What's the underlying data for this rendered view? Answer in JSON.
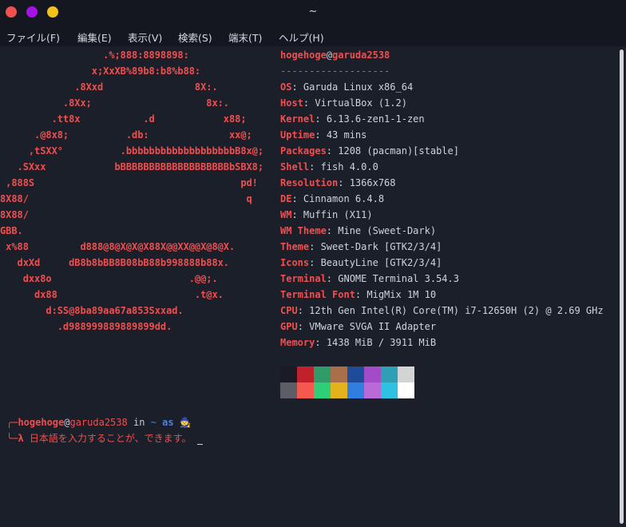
{
  "window": {
    "title": "~"
  },
  "menu": [
    "ファイル(F)",
    "編集(E)",
    "表示(V)",
    "検索(S)",
    "端末(T)",
    "ヘルプ(H)"
  ],
  "logo": [
    "                  .%;888:8898898:",
    "                x;XxXB%89b8:b8%b88:",
    "             .8Xxd                8X:.",
    "           .8Xx;                    8x:.",
    "         .tt8x           .d            x88;",
    "      .@8x8;          .db:              xx@;",
    "     ,tSXX°          .bbbbbbbbbbbbbbbbbbbB8x@;",
    "   .SXxx            bBBBBBBBBBBBBBBBBBBBbSBX8;",
    " ,888S                                    pd!",
    "8X88/                                      q",
    "8X88/",
    "GBB.",
    " x%88         d888@8@X@X@X88X@@XX@@X@8@X.",
    "   dxXd     dB8b8bBB8B08bB88b998888b88x.",
    "    dxx8o                        .@@;.",
    "      dx88                        .t@x.",
    "        d:SS@8ba89aa67a853Sxxad.",
    "          .d988999889889899dd."
  ],
  "system": {
    "user": "hogehoge",
    "host": "garuda2538",
    "separator": "-------------------",
    "fields": [
      {
        "key": "OS",
        "value": "Garuda Linux x86_64"
      },
      {
        "key": "Host",
        "value": "VirtualBox (1.2)"
      },
      {
        "key": "Kernel",
        "value": "6.13.6-zen1-1-zen"
      },
      {
        "key": "Uptime",
        "value": "43 mins"
      },
      {
        "key": "Packages",
        "value": "1208 (pacman)[stable]"
      },
      {
        "key": "Shell",
        "value": "fish 4.0.0"
      },
      {
        "key": "Resolution",
        "value": "1366x768"
      },
      {
        "key": "DE",
        "value": "Cinnamon 6.4.8"
      },
      {
        "key": "WM",
        "value": "Muffin (X11)"
      },
      {
        "key": "WM Theme",
        "value": "Mine (Sweet-Dark)"
      },
      {
        "key": "Theme",
        "value": "Sweet-Dark [GTK2/3/4]"
      },
      {
        "key": "Icons",
        "value": "BeautyLine [GTK2/3/4]"
      },
      {
        "key": "Terminal",
        "value": "GNOME Terminal 3.54.3"
      },
      {
        "key": "Terminal Font",
        "value": "MigMix 1M 10"
      },
      {
        "key": "CPU",
        "value": "12th Gen Intel(R) Core(TM) i7-12650H (2) @ 2.69 GHz"
      },
      {
        "key": "GPU",
        "value": "VMware SVGA II Adapter"
      },
      {
        "key": "Memory",
        "value": "1438 MiB / 3911 MiB"
      }
    ]
  },
  "palette": {
    "normal": [
      "#1b1b28",
      "#c0212b",
      "#2e9b69",
      "#a8704a",
      "#1e4b9a",
      "#a44bc7",
      "#2ea0b5",
      "#d4d4d4"
    ],
    "bright": [
      "#5c5d66",
      "#f4584f",
      "#2fcf7a",
      "#e4b21c",
      "#2f7ee0",
      "#b96ad8",
      "#2ec1e0",
      "#ffffff"
    ]
  },
  "prompt": {
    "user": "hogehoge",
    "host": "garuda2538",
    "in_word": "in",
    "dir": "~",
    "as_word": "as",
    "emoji": "🧙",
    "symbol": "λ",
    "input": "日本語を入力することが、できます。"
  }
}
